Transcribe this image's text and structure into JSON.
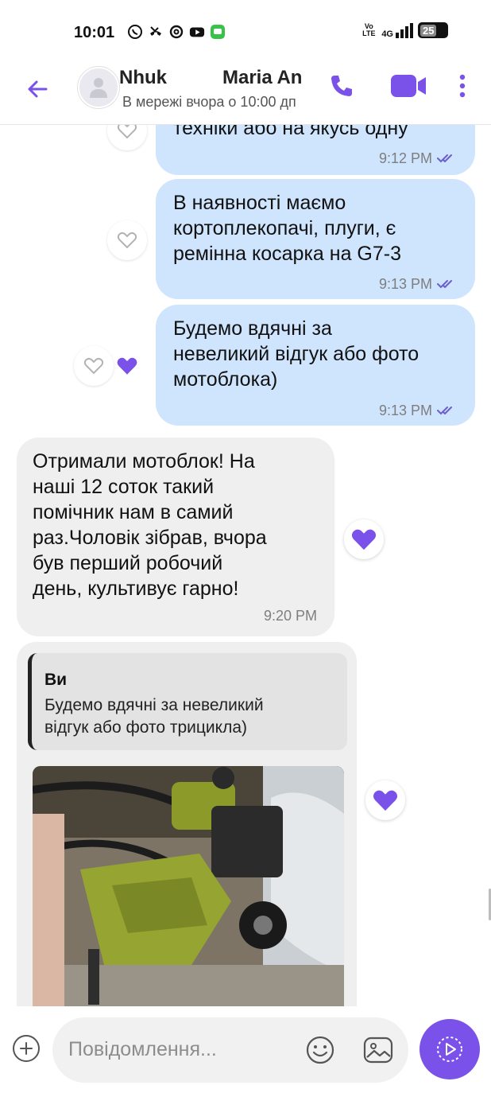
{
  "status_bar": {
    "time": "10:01",
    "network": "4G",
    "volte": "Vo LTE",
    "battery": "25",
    "app_icons": [
      "viber-icon",
      "missed-call-icon",
      "threads-icon",
      "youtube-icon",
      "messages-icon"
    ]
  },
  "header": {
    "contact_nickname": "Nhuk",
    "contact_name": "Maria An",
    "last_seen": "В мережі вчора о 10:00 дп"
  },
  "messages": [
    {
      "direction": "outgoing",
      "text": "техніки або на якусь одну",
      "time": "9:12 PM",
      "read": true
    },
    {
      "direction": "outgoing",
      "text": "В наявності маємо\nкортоплекопачі, плуги, є\nремінна косарка на G7-3",
      "time": "9:13 PM",
      "read": true
    },
    {
      "direction": "outgoing",
      "text": "Будемо вдячні за\nневеликий відгук або фото\nмотоблока)",
      "time": "9:13 PM",
      "read": true,
      "liked": true
    },
    {
      "direction": "incoming",
      "text": "Отримали мотоблок! На\nнаші 12 соток такий\nпомічник нам в самий\nраз.Чоловік зібрав, вчора\nбув перший робочий\nдень, культивує гарно!",
      "time": "9:20 PM",
      "liked": true
    },
    {
      "direction": "incoming",
      "type": "photo_reply",
      "quote_author": "Ви",
      "quote_text": "Будемо вдячні за невеликий\nвідгук або фото трицикла)",
      "liked": true
    }
  ],
  "composer": {
    "placeholder": "Повідомлення..."
  },
  "colors": {
    "accent": "#7b52e9",
    "outgoing_bubble": "#cfe4fd",
    "incoming_bubble": "#efefef",
    "read_ticks": "#6c5fd0"
  }
}
